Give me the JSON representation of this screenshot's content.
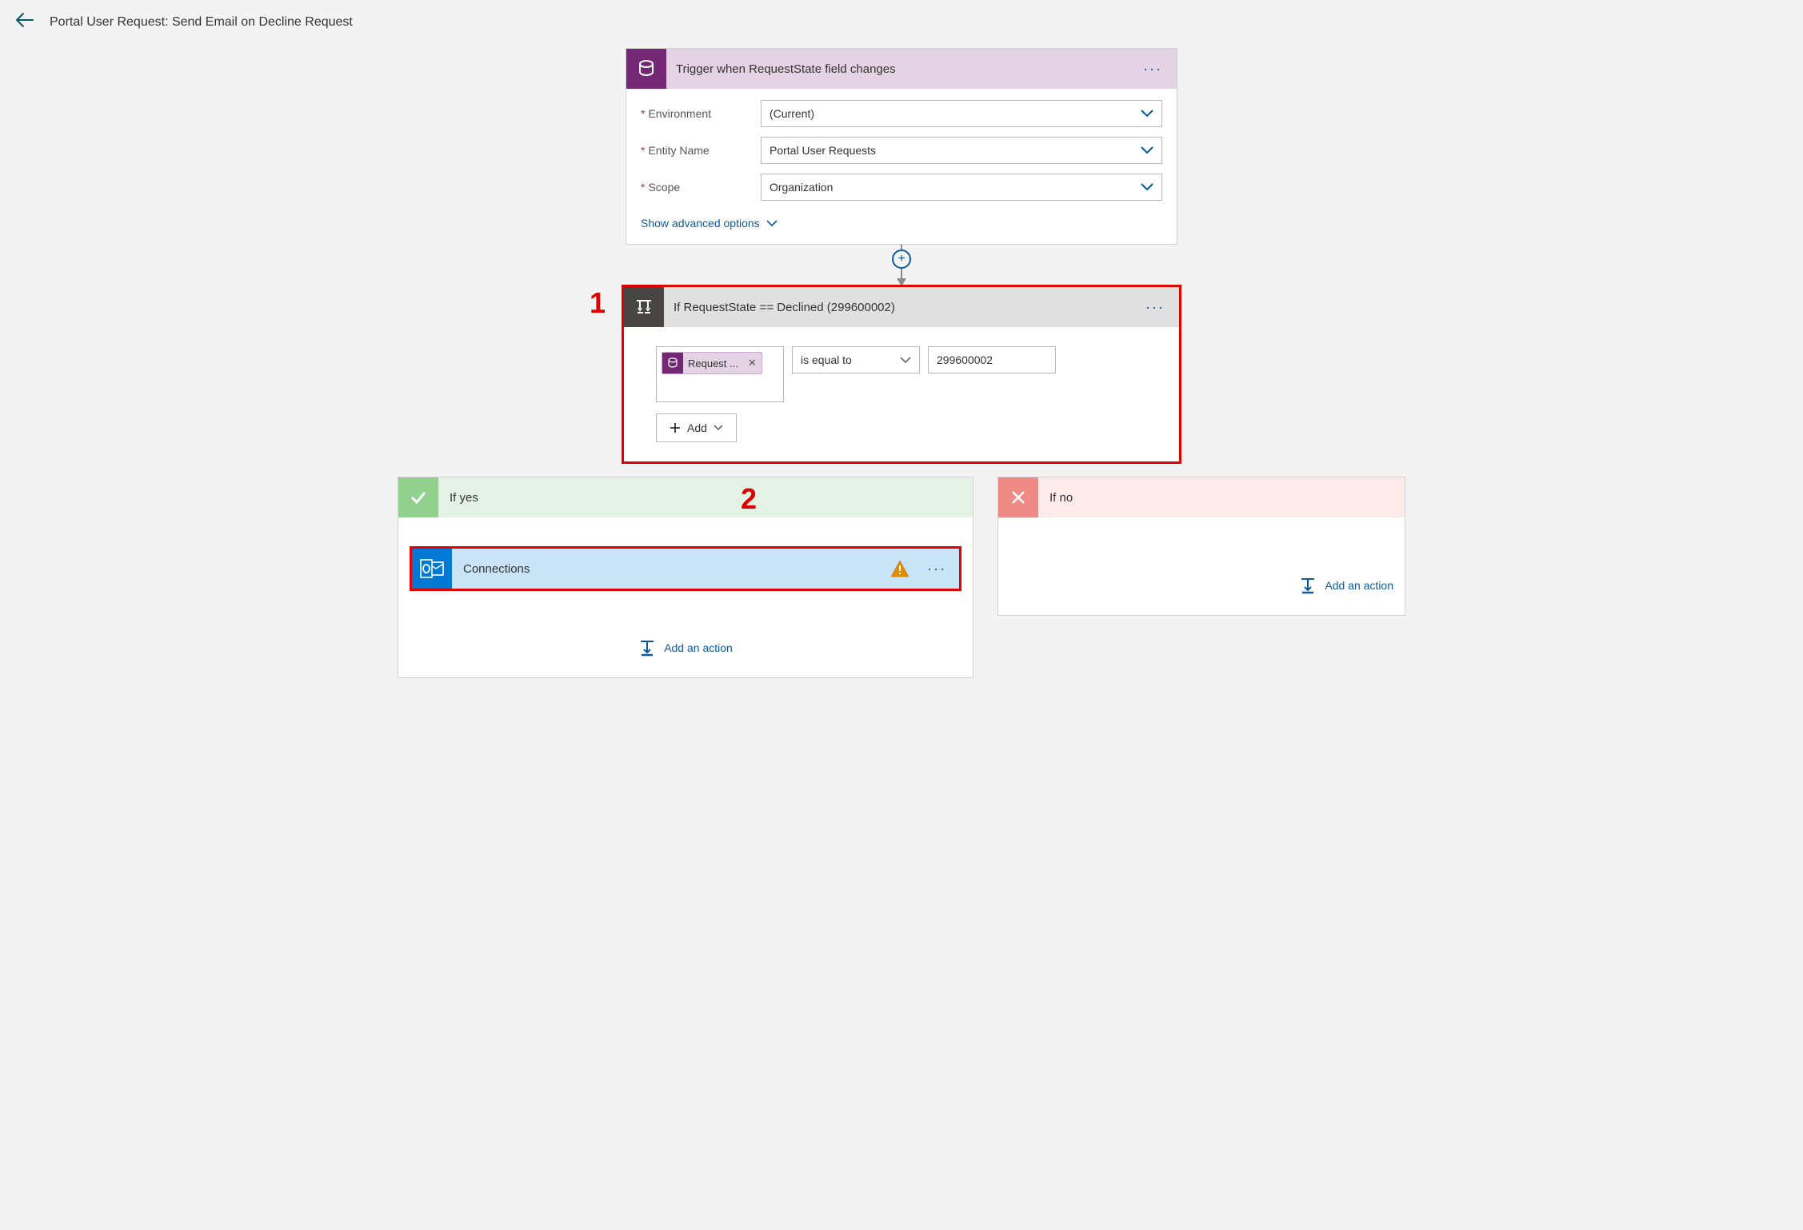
{
  "header": {
    "title": "Portal User Request: Send Email on Decline Request"
  },
  "trigger": {
    "title": "Trigger when RequestState field changes",
    "fields": {
      "environment_label": "Environment",
      "environment_value": "(Current)",
      "entity_label": "Entity Name",
      "entity_value": "Portal User Requests",
      "scope_label": "Scope",
      "scope_value": "Organization"
    },
    "advanced_label": "Show advanced options"
  },
  "condition": {
    "title": "If RequestState == Declined (299600002)",
    "token_label": "Request ...",
    "operator": "is equal to",
    "value": "299600002",
    "add_label": "Add"
  },
  "branches": {
    "yes_label": "If yes",
    "no_label": "If no",
    "add_action_label": "Add an action",
    "connections_label": "Connections"
  },
  "annotations": {
    "one": "1",
    "two": "2"
  }
}
